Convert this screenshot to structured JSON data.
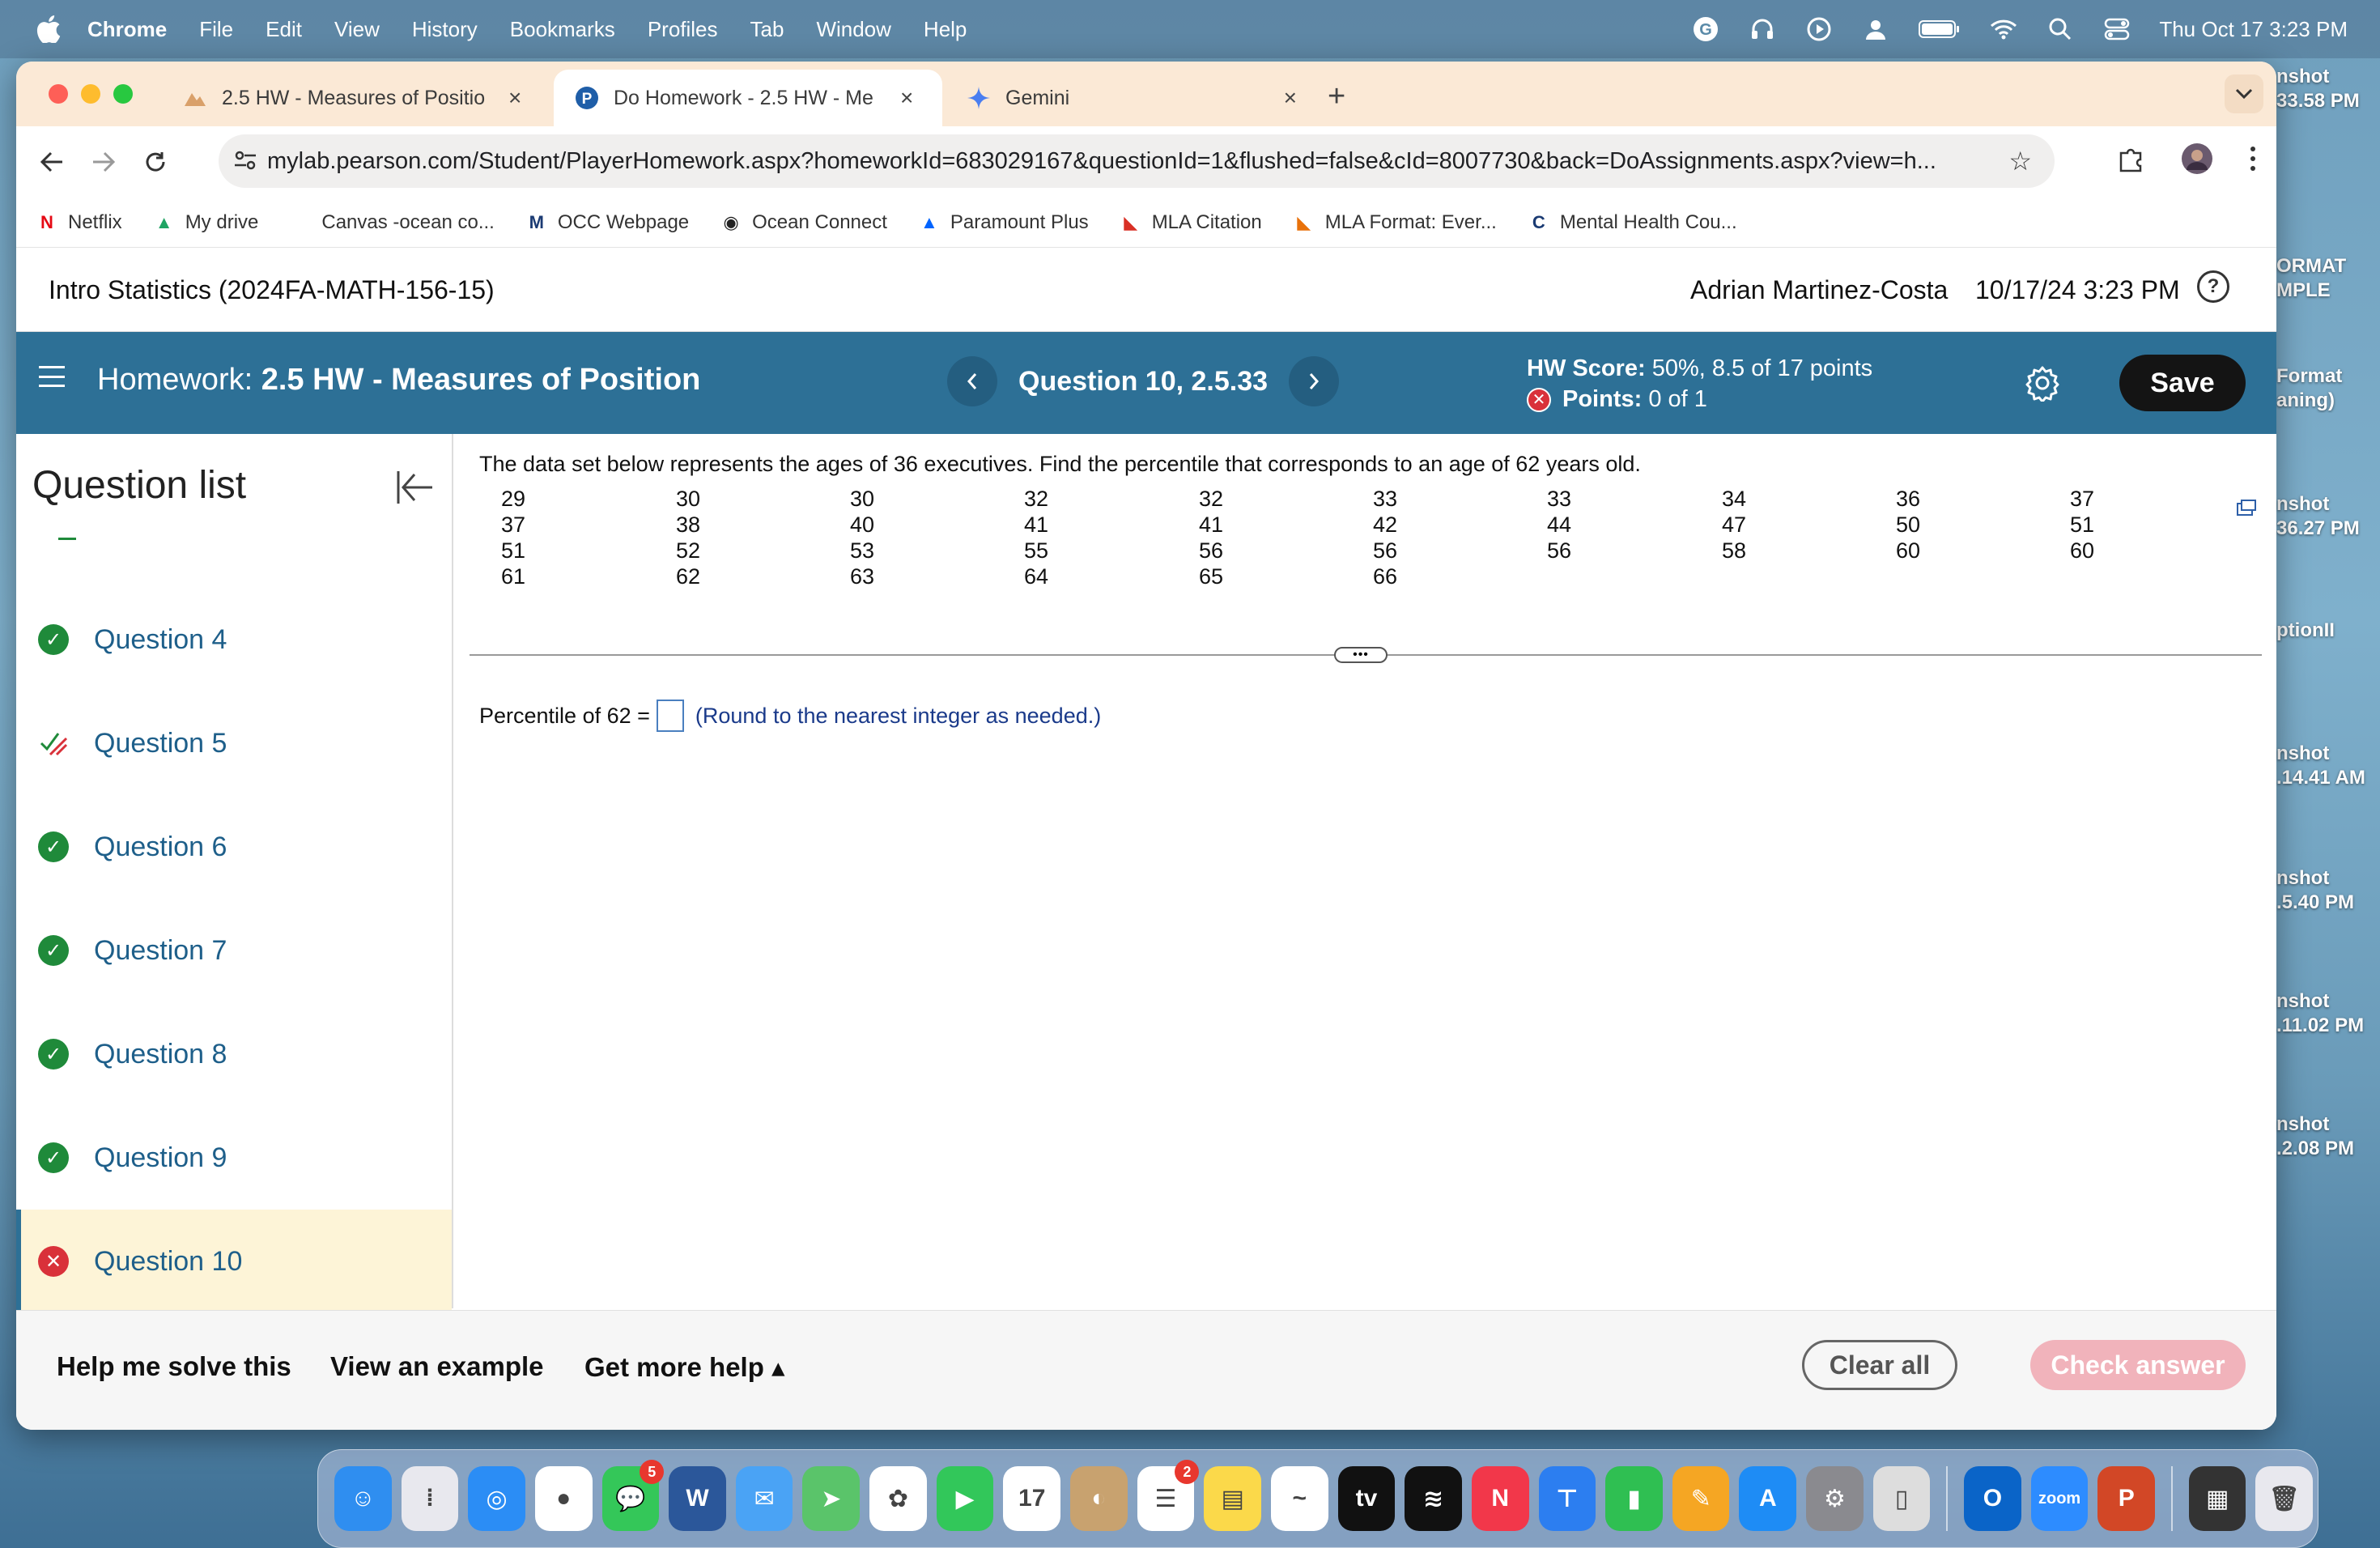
{
  "menubar": {
    "app": "Chrome",
    "items": [
      "File",
      "Edit",
      "View",
      "History",
      "Bookmarks",
      "Profiles",
      "Tab",
      "Window",
      "Help"
    ],
    "clock": "Thu Oct 17  3:23 PM"
  },
  "tabs": [
    {
      "label": "2.5 HW - Measures of Positio",
      "active": false
    },
    {
      "label": "Do Homework - 2.5 HW - Me",
      "active": true
    },
    {
      "label": "Gemini",
      "active": false
    }
  ],
  "tab_close": "×",
  "tab_new": "+",
  "address": {
    "url": "mylab.pearson.com/Student/PlayerHomework.aspx?homeworkId=683029167&questionId=1&flushed=false&cId=8007730&back=DoAssignments.aspx?view=h..."
  },
  "bookmarks": [
    {
      "label": "Netflix",
      "icon": "netflix-icon",
      "glyph": "N",
      "color": "#e50914"
    },
    {
      "label": "My drive",
      "icon": "drive-icon",
      "glyph": "▲",
      "color": "#1fa463"
    },
    {
      "label": "Canvas -ocean co...",
      "icon": "canvas-icon",
      "glyph": "",
      "color": "#ffffff"
    },
    {
      "label": "OCC Webpage",
      "icon": "occ-icon",
      "glyph": "M",
      "color": "#1b3b73"
    },
    {
      "label": "Ocean Connect",
      "icon": "globe-icon",
      "glyph": "◉",
      "color": "#222222"
    },
    {
      "label": "Paramount Plus",
      "icon": "paramount-icon",
      "glyph": "▲",
      "color": "#0064ff"
    },
    {
      "label": "MLA Citation",
      "icon": "bookmark-flag-icon",
      "glyph": "◣",
      "color": "#d93025"
    },
    {
      "label": "MLA Format: Ever...",
      "icon": "bookmark-flag-icon",
      "glyph": "◣",
      "color": "#e8710a"
    },
    {
      "label": "Mental Health Cou...",
      "icon": "mental-health-icon",
      "glyph": "C",
      "color": "#1b3b73"
    }
  ],
  "course": {
    "title": "Intro Statistics (2024FA-MATH-156-15)",
    "user": "Adrian Martinez-Costa",
    "datetime": "10/17/24 3:23 PM"
  },
  "homework": {
    "prefix": "Homework:",
    "name": "2.5 HW - Measures of Position",
    "question_label": "Question 10, 2.5.33",
    "score_label": "HW Score:",
    "score_value": "50%, 8.5 of 17 points",
    "points_label": "Points:",
    "points_value": "0 of 1",
    "save": "Save"
  },
  "sidebar": {
    "title": "Question list",
    "items": [
      {
        "label": "Question 4",
        "status": "correct"
      },
      {
        "label": "Question 5",
        "status": "partial"
      },
      {
        "label": "Question 6",
        "status": "correct"
      },
      {
        "label": "Question 7",
        "status": "correct"
      },
      {
        "label": "Question 8",
        "status": "correct"
      },
      {
        "label": "Question 9",
        "status": "correct"
      },
      {
        "label": "Question 10",
        "status": "incorrect"
      }
    ]
  },
  "question": {
    "prompt": "The data set below represents the ages of 36 executives. Find the percentile that corresponds to an age of 62 years old.",
    "columns": [
      [
        "29",
        "37",
        "51",
        "61"
      ],
      [
        "30",
        "38",
        "52",
        "62"
      ],
      [
        "30",
        "40",
        "53",
        "63"
      ],
      [
        "32",
        "41",
        "55",
        "64"
      ],
      [
        "32",
        "41",
        "56",
        "65"
      ],
      [
        "33",
        "42",
        "56",
        "66"
      ],
      [
        "33",
        "44",
        "56"
      ],
      [
        "34",
        "47",
        "58"
      ],
      [
        "36",
        "50",
        "60"
      ],
      [
        "37",
        "51",
        "60"
      ]
    ],
    "answer_label": "Percentile of 62 =",
    "answer_value": "",
    "answer_hint": "(Round to the nearest integer as needed.)",
    "divider_handle": "•••"
  },
  "footer": {
    "help": "Help me solve this",
    "example": "View an example",
    "more": "Get more help ▴",
    "clear": "Clear all",
    "check": "Check answer"
  },
  "desktop_items": [
    "nshot",
    "33.58 PM",
    "ORMAT",
    "MPLE",
    "Format",
    "aning)",
    "nshot",
    "36.27 PM",
    "ptionII",
    "nshot",
    ".14.41 AM",
    "nshot",
    ".5.40 PM",
    "nshot",
    ".11.02 PM",
    "nshot",
    ".2.08 PM"
  ],
  "dock": [
    {
      "name": "finder-icon",
      "color": "#2f8ef0",
      "glyph": "☺"
    },
    {
      "name": "launchpad-icon",
      "color": "#e8e8ee",
      "glyph": "⁞"
    },
    {
      "name": "safari-icon",
      "color": "#2b8df5",
      "glyph": "◎"
    },
    {
      "name": "chrome-icon",
      "color": "#ffffff",
      "glyph": "●"
    },
    {
      "name": "messages-icon",
      "color": "#34c759",
      "glyph": "💬",
      "badge": "5"
    },
    {
      "name": "word-icon",
      "color": "#2b579a",
      "glyph": "W"
    },
    {
      "name": "mail-icon",
      "color": "#4aa3f5",
      "glyph": "✉"
    },
    {
      "name": "maps-icon",
      "color": "#5ac46a",
      "glyph": "➤"
    },
    {
      "name": "photos-icon",
      "color": "#ffffff",
      "glyph": "✿"
    },
    {
      "name": "facetime-icon",
      "color": "#32c75a",
      "glyph": "▶"
    },
    {
      "name": "calendar-icon",
      "color": "#ffffff",
      "glyph": "17"
    },
    {
      "name": "contacts-icon",
      "color": "#c8a26f",
      "glyph": "◐"
    },
    {
      "name": "reminders-icon",
      "color": "#ffffff",
      "glyph": "☰",
      "badge": "2"
    },
    {
      "name": "notes-icon",
      "color": "#fbd94a",
      "glyph": "▤"
    },
    {
      "name": "freeform-icon",
      "color": "#ffffff",
      "glyph": "~"
    },
    {
      "name": "apple-tv-icon",
      "color": "#111111",
      "glyph": "tv"
    },
    {
      "name": "spotify-icon",
      "color": "#111111",
      "glyph": "≋"
    },
    {
      "name": "news-icon",
      "color": "#f2374a",
      "glyph": "N"
    },
    {
      "name": "keynote-icon",
      "color": "#2c7ef0",
      "glyph": "⊤"
    },
    {
      "name": "numbers-icon",
      "color": "#2fbf52",
      "glyph": "▮"
    },
    {
      "name": "pages-icon",
      "color": "#f5a623",
      "glyph": "✎"
    },
    {
      "name": "app-store-icon",
      "color": "#1e8cf5",
      "glyph": "A"
    },
    {
      "name": "system-settings-icon",
      "color": "#8a8a8f",
      "glyph": "⚙"
    },
    {
      "name": "iphone-mirroring-icon",
      "color": "#dddddd",
      "glyph": "▯"
    },
    {
      "name": "outlook-icon",
      "color": "#0a64c8",
      "glyph": "O"
    },
    {
      "name": "zoom-icon",
      "color": "#2d8cff",
      "glyph": "zoom"
    },
    {
      "name": "powerpoint-icon",
      "color": "#d24726",
      "glyph": "P"
    },
    {
      "name": "screenshot-thumb-icon",
      "color": "#333333",
      "glyph": "▦"
    },
    {
      "name": "trash-icon",
      "color": "#e8e8ee",
      "glyph": "🗑"
    }
  ],
  "colors": {
    "header_blue": "#2d7096",
    "correct_green": "#1f8a3a",
    "incorrect_red": "#d9313a",
    "link_blue": "#1e5f8a",
    "current_row_bg": "#fdf4d7",
    "check_button_disabled": "#f1b3bb"
  }
}
